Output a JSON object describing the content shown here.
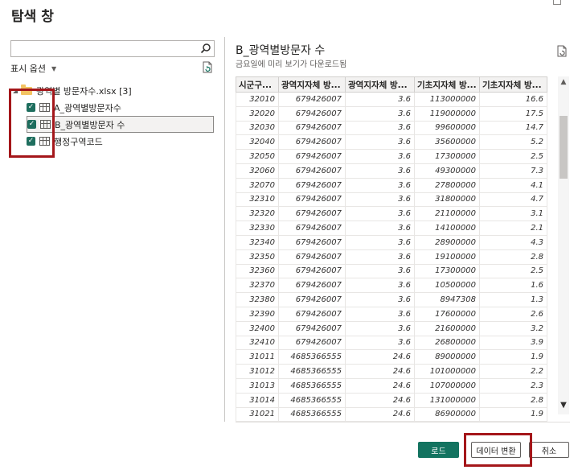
{
  "window": {
    "title": "탐색 창"
  },
  "left_pane": {
    "search": {
      "value": "",
      "placeholder": ""
    },
    "view_options_label": "표시 옵션",
    "tree": {
      "root_label": "광역별 방문자수.xlsx [3]",
      "items": [
        {
          "label": "A_광역별방문자수",
          "checked": true,
          "selected": false
        },
        {
          "label": "B_광역별방문자 수",
          "checked": true,
          "selected": true
        },
        {
          "label": "행정구역코드",
          "checked": true,
          "selected": false
        }
      ]
    }
  },
  "preview": {
    "title": "B_광역별방문자 수",
    "subtitle": "금요일에 미리 보기가 다운로드됨",
    "columns": [
      "시군구...",
      "광역지자체 방...",
      "광역지자체 방...",
      "기초지자체 방...",
      "기초지자체 방..."
    ],
    "rows": [
      [
        "32010",
        "679426007",
        "3.6",
        "113000000",
        "16.6"
      ],
      [
        "32020",
        "679426007",
        "3.6",
        "119000000",
        "17.5"
      ],
      [
        "32030",
        "679426007",
        "3.6",
        "99600000",
        "14.7"
      ],
      [
        "32040",
        "679426007",
        "3.6",
        "35600000",
        "5.2"
      ],
      [
        "32050",
        "679426007",
        "3.6",
        "17300000",
        "2.5"
      ],
      [
        "32060",
        "679426007",
        "3.6",
        "49300000",
        "7.3"
      ],
      [
        "32070",
        "679426007",
        "3.6",
        "27800000",
        "4.1"
      ],
      [
        "32310",
        "679426007",
        "3.6",
        "31800000",
        "4.7"
      ],
      [
        "32320",
        "679426007",
        "3.6",
        "21100000",
        "3.1"
      ],
      [
        "32330",
        "679426007",
        "3.6",
        "14100000",
        "2.1"
      ],
      [
        "32340",
        "679426007",
        "3.6",
        "28900000",
        "4.3"
      ],
      [
        "32350",
        "679426007",
        "3.6",
        "19100000",
        "2.8"
      ],
      [
        "32360",
        "679426007",
        "3.6",
        "17300000",
        "2.5"
      ],
      [
        "32370",
        "679426007",
        "3.6",
        "10500000",
        "1.6"
      ],
      [
        "32380",
        "679426007",
        "3.6",
        "8947308",
        "1.3"
      ],
      [
        "32390",
        "679426007",
        "3.6",
        "17600000",
        "2.6"
      ],
      [
        "32400",
        "679426007",
        "3.6",
        "21600000",
        "3.2"
      ],
      [
        "32410",
        "679426007",
        "3.6",
        "26800000",
        "3.9"
      ],
      [
        "31011",
        "4685366555",
        "24.6",
        "89000000",
        "1.9"
      ],
      [
        "31012",
        "4685366555",
        "24.6",
        "101000000",
        "2.2"
      ],
      [
        "31013",
        "4685366555",
        "24.6",
        "107000000",
        "2.3"
      ],
      [
        "31014",
        "4685366555",
        "24.6",
        "131000000",
        "2.8"
      ],
      [
        "31021",
        "4685366555",
        "24.6",
        "86900000",
        "1.9"
      ]
    ]
  },
  "buttons": {
    "load": "로드",
    "transform": "데이터 변환",
    "cancel": "취소"
  },
  "colors": {
    "accent": "#137360",
    "checkbox": "#1e6e5e",
    "highlight_box": "#a4161a"
  }
}
